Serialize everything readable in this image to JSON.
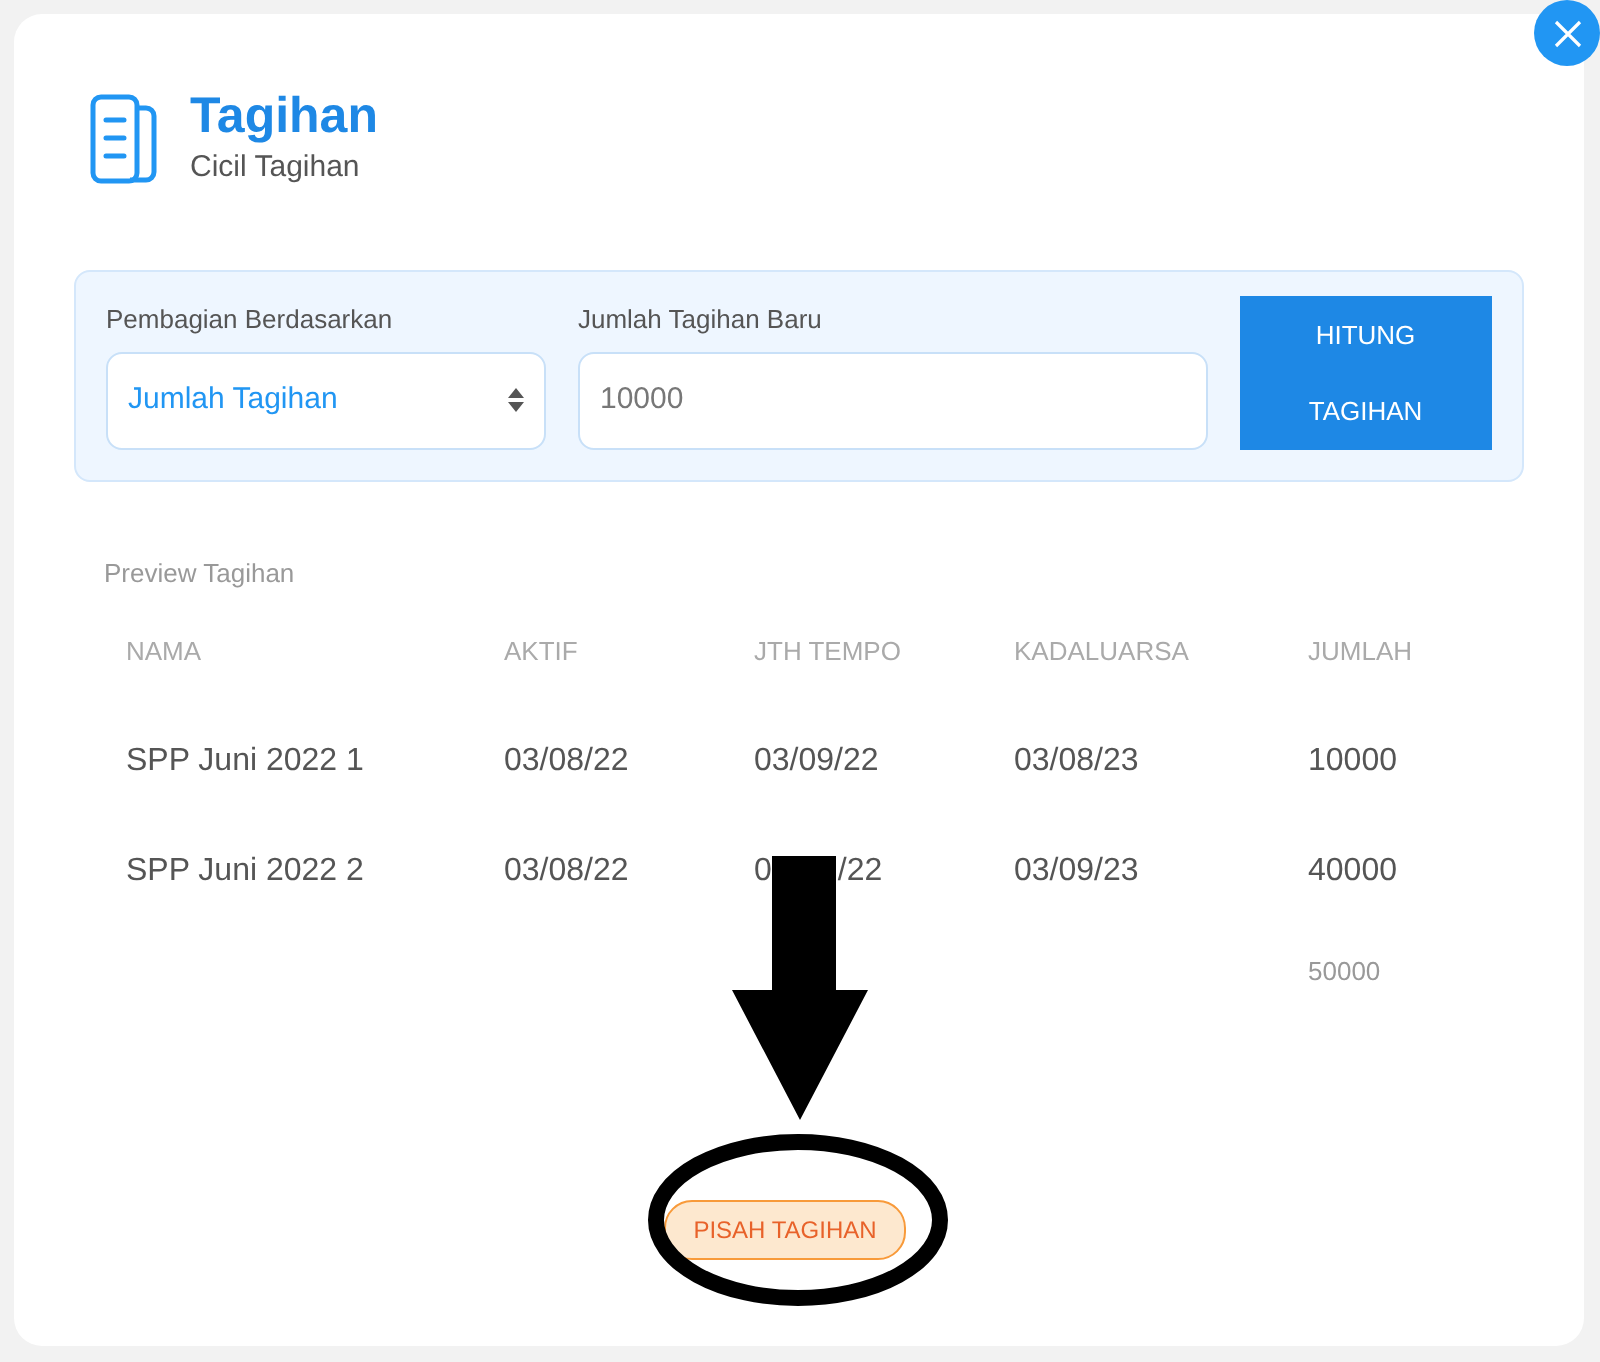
{
  "header": {
    "title": "Tagihan",
    "subtitle": "Cicil Tagihan"
  },
  "form": {
    "split_label": "Pembagian Berdasarkan",
    "split_value": "Jumlah Tagihan",
    "amount_label": "Jumlah Tagihan Baru",
    "amount_value": "10000",
    "calculate_button": [
      "HITUNG",
      "TAGIHAN"
    ]
  },
  "preview": {
    "title": "Preview Tagihan",
    "columns": [
      "NAMA",
      "AKTIF",
      "JTH TEMPO",
      "KADALUARSA",
      "JUMLAH"
    ],
    "rows": [
      [
        "SPP Juni 2022 1",
        "03/08/22",
        "03/09/22",
        "03/08/23",
        "10000"
      ],
      [
        "SPP Juni 2022 2",
        "03/08/22",
        [
          "0",
          "/22"
        ],
        "03/09/23",
        "40000"
      ]
    ],
    "total": "50000"
  },
  "split_button": "PISAH TAGIHAN"
}
